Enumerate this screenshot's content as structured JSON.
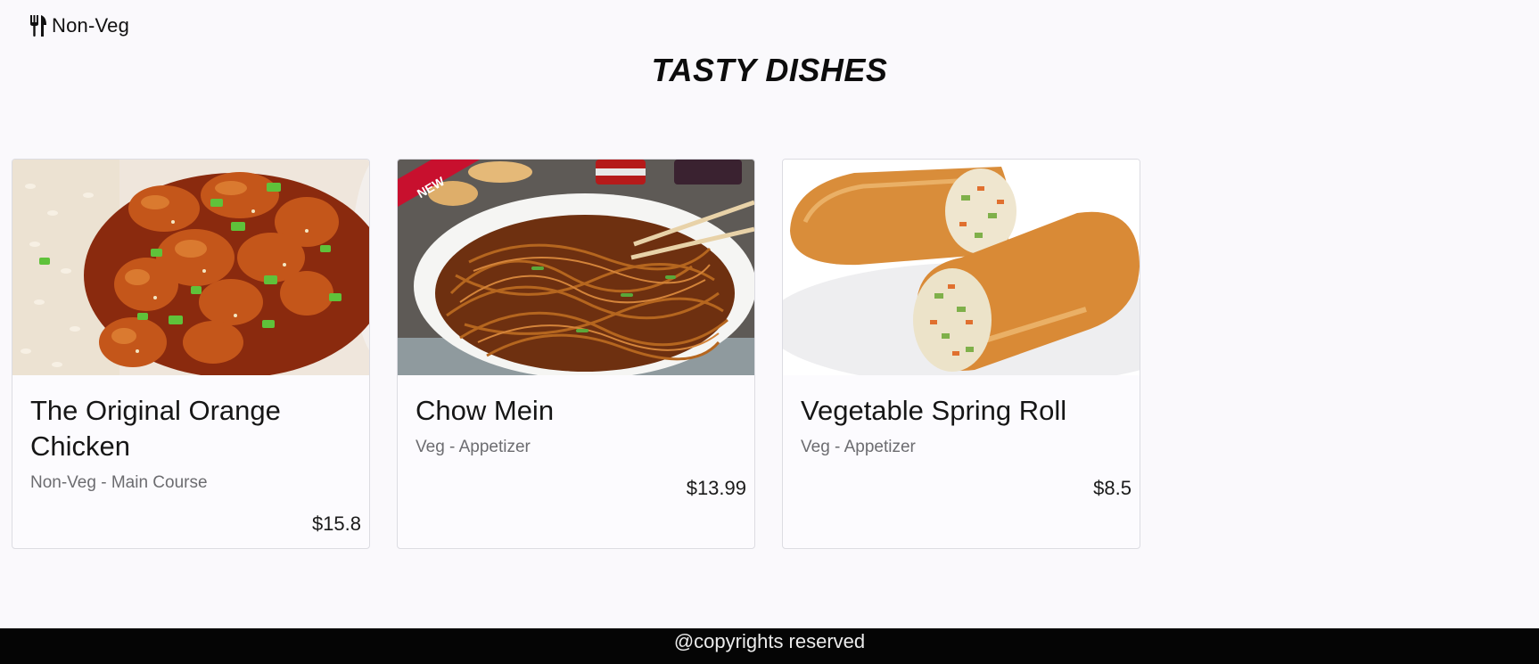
{
  "nav": {
    "icon": "fork-knife-icon",
    "label": "Non-Veg"
  },
  "page_title": "TASTY DISHES",
  "cards": [
    {
      "image": "orange-chicken-photo",
      "title": "The Original Orange Chicken",
      "subtitle": "Non-Veg - Main Course",
      "price": "$15.8"
    },
    {
      "image": "chow-mein-photo",
      "badge": "NEW",
      "title": "Chow Mein",
      "subtitle": "Veg - Appetizer",
      "price": "$13.99"
    },
    {
      "image": "spring-roll-photo",
      "title": "Vegetable Spring Roll",
      "subtitle": "Veg - Appetizer",
      "price": "$8.5"
    }
  ],
  "footer": {
    "text": "@copyrights reserved"
  },
  "colors": {
    "background": "#faf9fc",
    "footer_background": "#050505",
    "badge": "#c8102e"
  }
}
